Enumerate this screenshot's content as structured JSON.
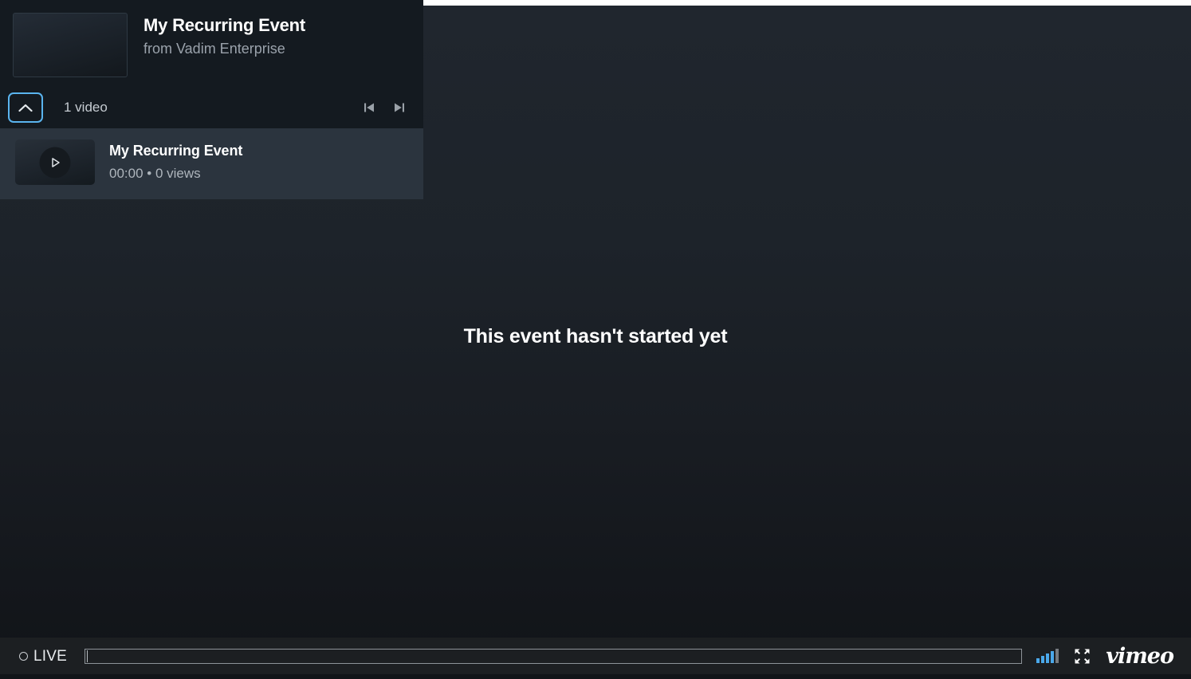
{
  "player": {
    "stage_message": "This event hasn't started yet",
    "accent_color": "#5ab4ef",
    "quality_color": "#4aa8ea",
    "background_color": "#1b2026"
  },
  "playlist": {
    "header": {
      "title": "My Recurring Event",
      "subtitle": "from Vadim Enterprise",
      "thumbnail_icon": "video-thumbnail",
      "collapse_icon": "chevron-up-icon",
      "video_count": "1 video",
      "prev_icon": "skip-previous-icon",
      "next_icon": "skip-next-icon"
    },
    "items": [
      {
        "title": "My Recurring Event",
        "meta": "00:00 • 0 views",
        "play_icon": "play-icon"
      }
    ]
  },
  "controls": {
    "live_label": "LIVE",
    "live_dot_icon": "live-circle-icon",
    "scrubber_position_percent": 0,
    "quality_icon": "signal-bars-icon",
    "fullscreen_icon": "fullscreen-icon",
    "brand": "vimeo"
  }
}
